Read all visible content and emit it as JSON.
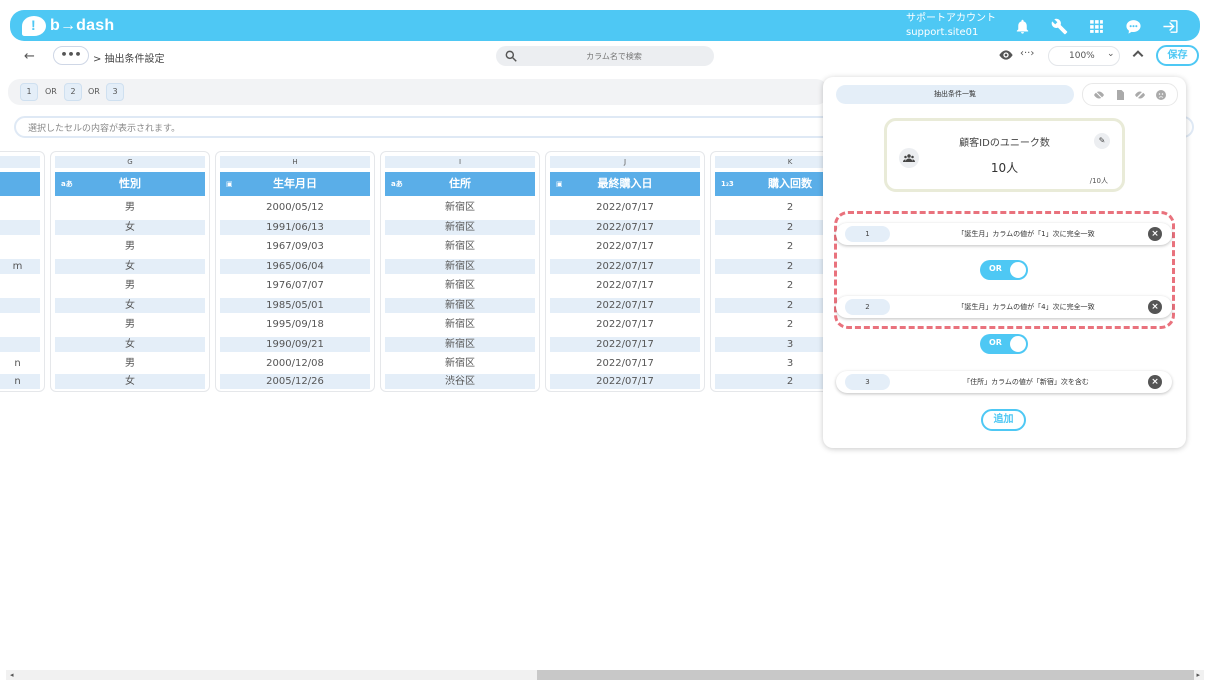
{
  "app": {
    "logo_text": "b→dash"
  },
  "account": {
    "line1": "サポートアカウント",
    "line2": "support.site01"
  },
  "topbar_icons": [
    "bell-icon",
    "wrench-icon",
    "grid-icon",
    "chat-icon",
    "logout-icon"
  ],
  "toolbar": {
    "back": "←",
    "ellipsis": "•••",
    "breadcrumb": "> 抽出条件設定",
    "search_placeholder": "カラム名で検索",
    "code": "‹··›",
    "zoom": "100%",
    "zoom_chevron": "⌄",
    "save_label": "保存"
  },
  "formula": {
    "items": [
      "1",
      "OR",
      "2",
      "OR",
      "3"
    ]
  },
  "cell_content_placeholder": "選択したセルの内容が表示されます。",
  "columns": [
    {
      "letter": "",
      "name": "",
      "type_icon": "",
      "cells": [
        "",
        "",
        "",
        "m",
        "",
        "",
        "",
        "",
        "n",
        "n"
      ]
    },
    {
      "letter": "G",
      "name": "性別",
      "type_icon": "aあ",
      "cells": [
        "男",
        "女",
        "男",
        "女",
        "男",
        "女",
        "男",
        "女",
        "男",
        "女"
      ]
    },
    {
      "letter": "H",
      "name": "生年月日",
      "type_icon": "▣",
      "cells": [
        "2000/05/12",
        "1991/06/13",
        "1967/09/03",
        "1965/06/04",
        "1976/07/07",
        "1985/05/01",
        "1995/09/18",
        "1990/09/21",
        "2000/12/08",
        "2005/12/26"
      ]
    },
    {
      "letter": "I",
      "name": "住所",
      "type_icon": "aあ",
      "cells": [
        "新宿区",
        "新宿区",
        "新宿区",
        "新宿区",
        "新宿区",
        "新宿区",
        "新宿区",
        "新宿区",
        "新宿区",
        "渋谷区"
      ]
    },
    {
      "letter": "J",
      "name": "最終購入日",
      "type_icon": "▣",
      "cells": [
        "2022/07/17",
        "2022/07/17",
        "2022/07/17",
        "2022/07/17",
        "2022/07/17",
        "2022/07/17",
        "2022/07/17",
        "2022/07/17",
        "2022/07/17",
        "2022/07/17"
      ]
    },
    {
      "letter": "K",
      "name": "購入回数",
      "type_icon": "1₂3",
      "cells": [
        "2",
        "2",
        "2",
        "2",
        "2",
        "2",
        "2",
        "3",
        "3",
        "2"
      ]
    }
  ],
  "panel": {
    "tab_label": "抽出条件一覧",
    "tool_icons": [
      "visibility-off-icon",
      "document-icon",
      "eye-off-icon",
      "sad-face-icon"
    ],
    "unique": {
      "title": "顧客IDのユニーク数",
      "count": "10人",
      "total": "/10人"
    },
    "conditions": [
      {
        "num": "1",
        "text": "「誕生月」カラムの値が「1」次に完全一致"
      },
      {
        "num": "2",
        "text": "「誕生月」カラムの値が「4」次に完全一致"
      },
      {
        "num": "3",
        "text": "「住所」カラムの値が「新宿」次を含む"
      }
    ],
    "toggles": [
      "OR",
      "OR"
    ],
    "add_label": "追加"
  },
  "scrollbar": {
    "left_arrow": "◂",
    "right_arrow": "▸"
  }
}
